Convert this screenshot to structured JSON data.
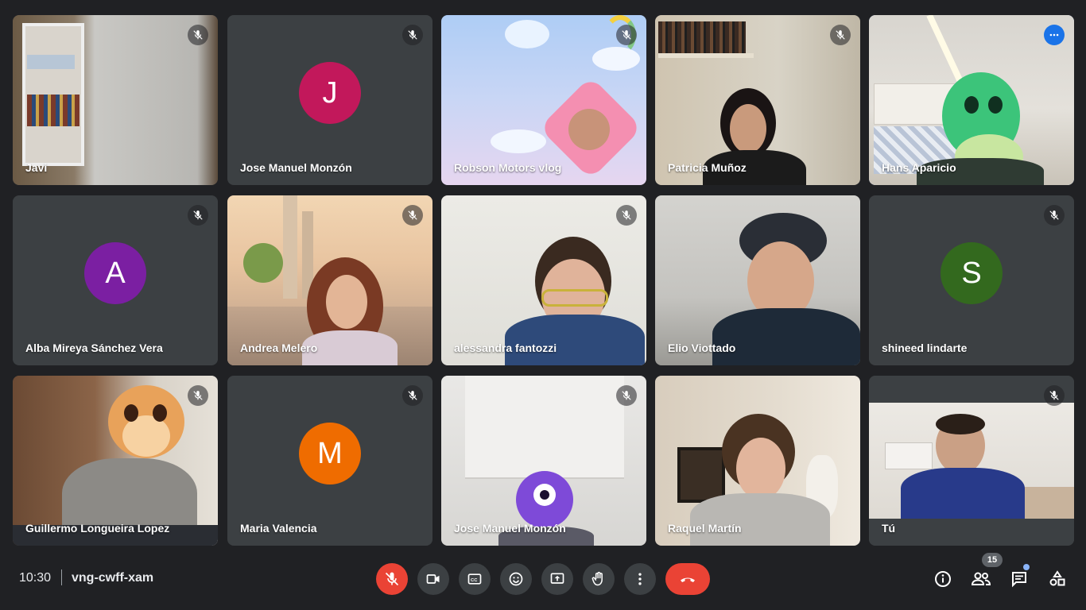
{
  "participants": [
    {
      "name": "Javi",
      "type": "video"
    },
    {
      "name": "Jose Manuel Monzón",
      "type": "avatar",
      "initial": "J",
      "color": "#c2185b"
    },
    {
      "name": "Robson Motors vlog",
      "type": "video"
    },
    {
      "name": "Patricia Muñoz",
      "type": "video"
    },
    {
      "name": "Hans Aparicio",
      "type": "video",
      "active": true
    },
    {
      "name": "Alba Mireya Sánchez Vera",
      "type": "avatar",
      "initial": "A",
      "color": "#7b1fa2"
    },
    {
      "name": "Andrea Melero",
      "type": "video"
    },
    {
      "name": "alessandra fantozzi",
      "type": "video"
    },
    {
      "name": "Elio Viottado",
      "type": "video"
    },
    {
      "name": "shineed lindarte",
      "type": "avatar",
      "initial": "S",
      "color": "#33691e"
    },
    {
      "name": "Guillermo Longueira Lopez",
      "type": "video"
    },
    {
      "name": "Maria Valencia",
      "type": "avatar",
      "initial": "M",
      "color": "#ef6c00"
    },
    {
      "name": "Jose Manuel Monzón",
      "type": "video"
    },
    {
      "name": "Raquel Martín",
      "type": "video"
    },
    {
      "name": "Tú",
      "type": "video"
    }
  ],
  "meeting": {
    "time": "10:30",
    "code": "vng-cwff-xam"
  },
  "controls": [
    "mic-off-icon",
    "camera-icon",
    "captions-icon",
    "emoji-icon",
    "present-icon",
    "raise-hand-icon",
    "more-vert-icon",
    "hang-up-icon"
  ],
  "right_panel": {
    "participant_count": "15"
  },
  "colors": {
    "background": "#202124",
    "tile": "#3c4043",
    "danger": "#ea4335",
    "accent": "#8ab4f8"
  }
}
